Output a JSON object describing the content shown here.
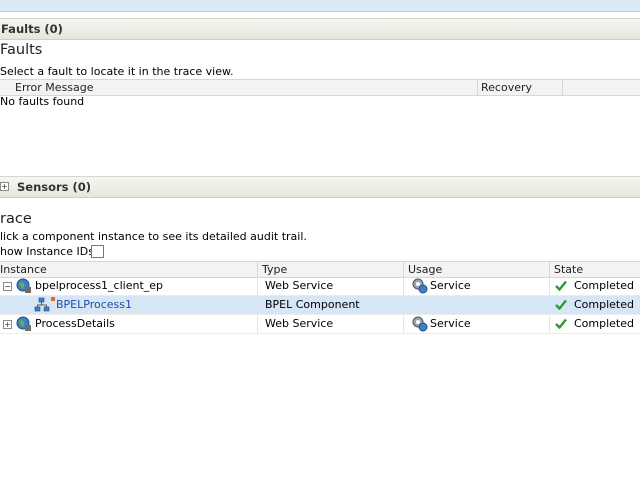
{
  "faults_band": {
    "label": "Faults (0)"
  },
  "faults": {
    "title": "Faults",
    "instruction": "Select a fault to locate it in the trace view.",
    "columns": [
      "Error Message",
      "Recovery"
    ],
    "empty_text": "No faults found"
  },
  "sensors_band": {
    "label": "Sensors (0)",
    "expander": "+"
  },
  "trace": {
    "title": "race",
    "instruction": "lick a component instance to see its detailed audit trail.",
    "show_ids_label": "how Instance IDs",
    "columns": [
      "Instance",
      "Type",
      "Usage",
      "State"
    ],
    "rows": [
      {
        "expander": "−",
        "instance": "bpelprocess1_client_ep",
        "type": "Web Service",
        "usage": "Service",
        "state": "Completed"
      },
      {
        "expander": "",
        "instance": "BPELProcess1",
        "type": "BPEL Component",
        "usage": "",
        "state": "Completed"
      },
      {
        "expander": "+",
        "instance": "ProcessDetails",
        "type": "Web Service",
        "usage": "Service",
        "state": "Completed"
      }
    ]
  }
}
